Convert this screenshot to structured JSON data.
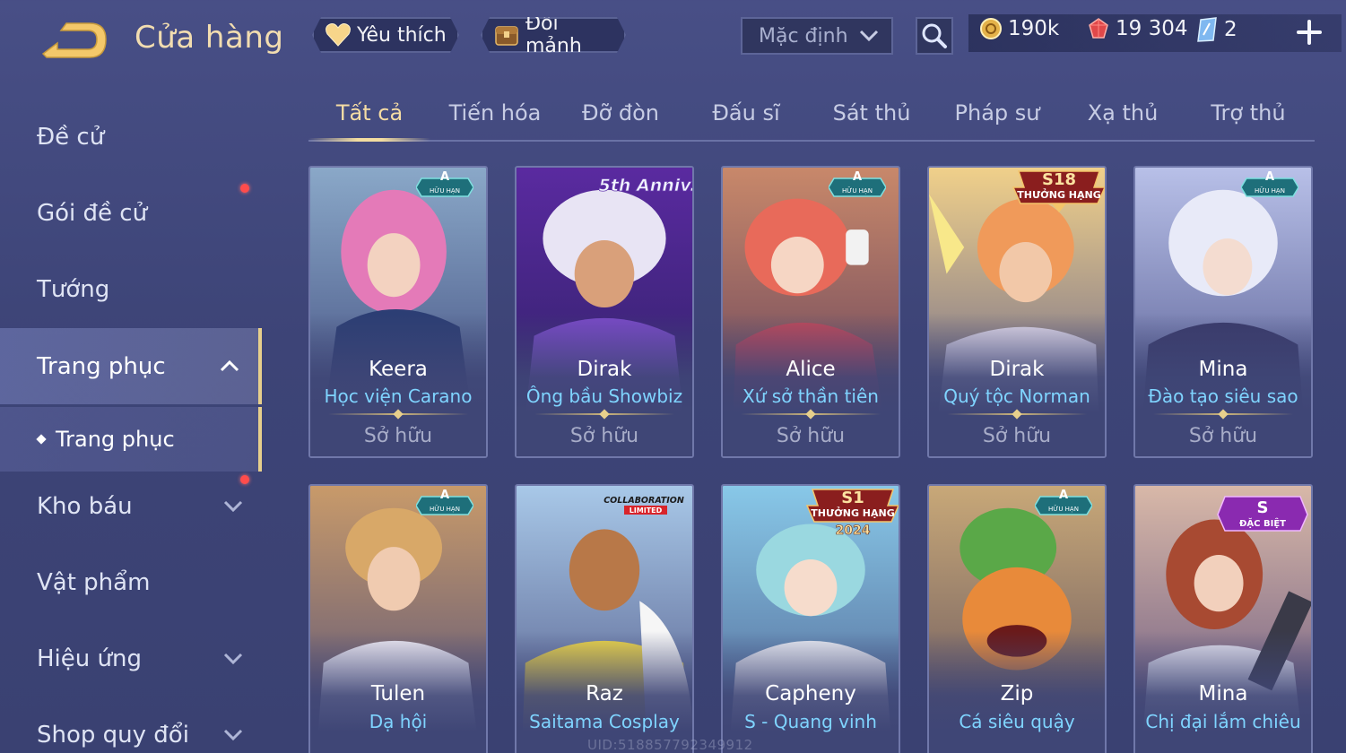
{
  "header": {
    "title": "Cửa hàng",
    "favorites_label": "Yêu thích",
    "fragments_label": "Đổi mảnh",
    "sort_value": "Mặc định",
    "gold": "190k",
    "gems": "19 304",
    "cards": "2",
    "colors": {
      "title": "#f2ddb0",
      "accent": "#e7cf8c"
    }
  },
  "sidebar": {
    "items": [
      {
        "label": "Đề cử"
      },
      {
        "label": "Gói đề cử"
      },
      {
        "label": "Tướng"
      },
      {
        "label": "Trang phục"
      },
      {
        "label": "Kho báu"
      },
      {
        "label": "Vật phẩm"
      },
      {
        "label": "Hiệu ứng"
      },
      {
        "label": "Shop quy đổi"
      }
    ],
    "sub_item": "Trang phục"
  },
  "tabs": [
    "Tất cả",
    "Tiến hóa",
    "Đỡ đòn",
    "Đấu sĩ",
    "Sát thủ",
    "Pháp sư",
    "Xạ thủ",
    "Trợ thủ"
  ],
  "badges": {
    "a_grade": "A",
    "limited": "HỮU HẠN",
    "rank_season_1": "S18",
    "rank_reward": "THƯỞNG HẠNG",
    "rank_season_2": "S1",
    "rank_year": "2024",
    "anniversary": "5th Anniv.",
    "collab_1": "COLLABORATION",
    "collab_2": "LIMITED",
    "s_grade": "S",
    "special": "ĐẶC BIỆT"
  },
  "skins": [
    {
      "hero": "Keera",
      "skin": "Học viện Carano",
      "status": "Sở hữu",
      "art_color": "#d46aa8"
    },
    {
      "hero": "Dirak",
      "skin": "Ông bầu Showbiz",
      "status": "Sở hữu",
      "art_color": "#6a3fb0"
    },
    {
      "hero": "Alice",
      "skin": "Xứ sở thần tiên",
      "status": "Sở hữu",
      "art_color": "#d86a6a"
    },
    {
      "hero": "Dirak",
      "skin": "Quý tộc Norman",
      "status": "Sở hữu",
      "art_color": "#e0a25a"
    },
    {
      "hero": "Mina",
      "skin": "Đào tạo siêu sao",
      "status": "Sở hữu",
      "art_color": "#9aa2d8"
    },
    {
      "hero": "Tulen",
      "skin": "Dạ hội",
      "art_color": "#b88a5a"
    },
    {
      "hero": "Raz",
      "skin": "Saitama Cosplay",
      "art_color": "#e0c84a"
    },
    {
      "hero": "Capheny",
      "skin": "S - Quang vinh",
      "art_color": "#7ac0e0"
    },
    {
      "hero": "Zip",
      "skin": "Cá siêu quậy",
      "art_color": "#6aa84a"
    },
    {
      "hero": "Mina",
      "skin": "Chị đại lắm chiêu",
      "art_color": "#c0604a"
    }
  ],
  "watermark": "UID:518857792349912"
}
